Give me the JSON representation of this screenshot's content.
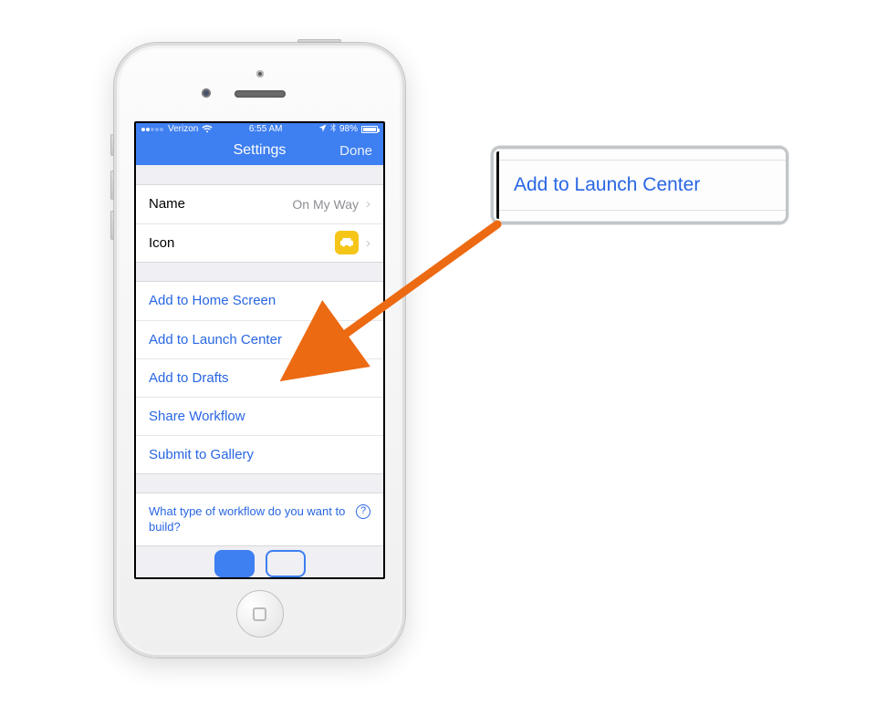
{
  "statusbar": {
    "carrier": "Verizon",
    "time": "6:55 AM",
    "battery_pct": "98%"
  },
  "navbar": {
    "title": "Settings",
    "done": "Done"
  },
  "form": {
    "name_label": "Name",
    "name_value": "On My Way",
    "icon_label": "Icon"
  },
  "actions": [
    "Add to Home Screen",
    "Add to Launch Center",
    "Add to Drafts",
    "Share Workflow",
    "Submit to Gallery"
  ],
  "help": {
    "text": "What type of workflow do you want to build?"
  },
  "callout": {
    "text": "Add to Launch Center"
  },
  "colors": {
    "nav_blue": "#3e7ff1",
    "link_blue": "#2866e3",
    "icon_chip": "#f5c518",
    "arrow": "#ec6a12"
  }
}
